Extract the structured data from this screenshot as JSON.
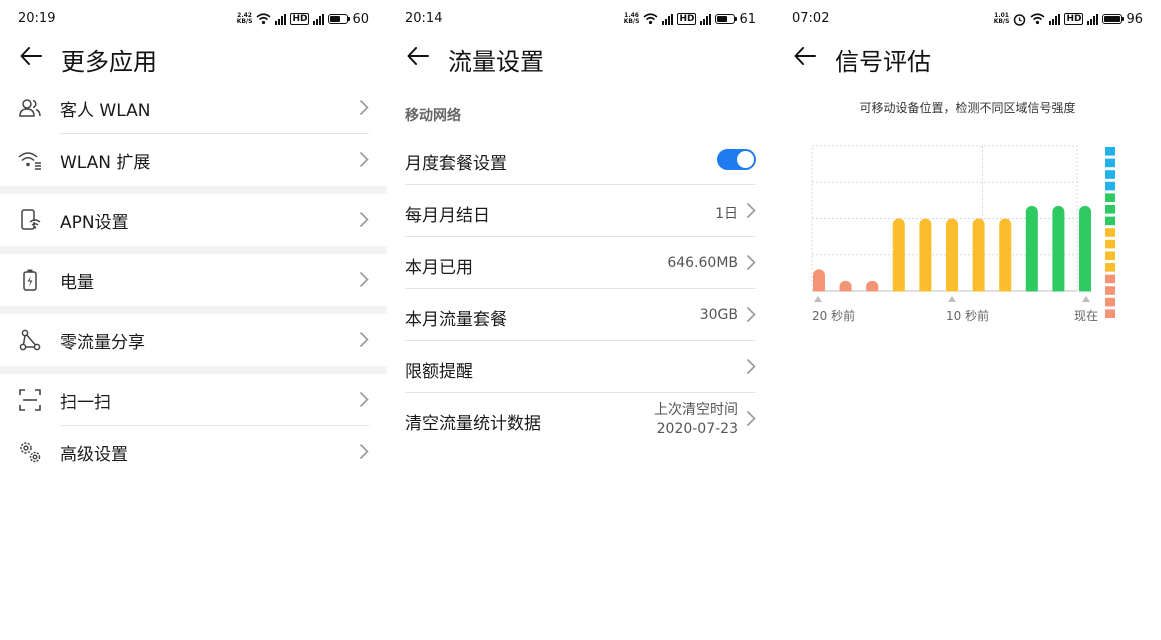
{
  "colors": {
    "accent": "#1e7cf0",
    "bar_weak": "#f39574",
    "bar_medium": "#fbbd2b",
    "bar_strong": "#2fc962",
    "legend_blue": "#22b1eb"
  },
  "panel1": {
    "status": {
      "time": "20:19",
      "speed_top": "2.42",
      "speed_bottom": "KB/S",
      "hd": "HD",
      "battery": "60",
      "battery_level": 0.6
    },
    "title": "更多应用",
    "items": [
      {
        "icon": "guest-users-icon",
        "label": "客人 WLAN"
      },
      {
        "icon": "wifi-extend-icon",
        "label": "WLAN 扩展"
      },
      {
        "icon": "apn-phone-icon",
        "label": "APN设置"
      },
      {
        "icon": "battery-charge-icon",
        "label": "电量"
      },
      {
        "icon": "share-nodes-icon",
        "label": "零流量分享"
      },
      {
        "icon": "scan-icon",
        "label": "扫一扫"
      },
      {
        "icon": "gears-icon",
        "label": "高级设置"
      }
    ]
  },
  "panel2": {
    "status": {
      "time": "20:14",
      "speed_top": "1.46",
      "speed_bottom": "KB/S",
      "hd": "HD",
      "battery": "61",
      "battery_level": 0.61
    },
    "title": "流量设置",
    "section": "移动网络",
    "items": [
      {
        "label": "月度套餐设置",
        "toggle": true
      },
      {
        "label": "每月月结日",
        "value": "1日"
      },
      {
        "label": "本月已用",
        "value": "646.60MB"
      },
      {
        "label": "本月流量套餐",
        "value": "30GB"
      },
      {
        "label": "限额提醒",
        "value": ""
      },
      {
        "label": "清空流量统计数据",
        "value_line1": "上次清空时间",
        "value_line2": "2020-07-23"
      }
    ]
  },
  "panel3": {
    "status": {
      "time": "07:02",
      "speed_top": "1.01",
      "speed_bottom": "KB/S",
      "hd": "HD",
      "battery": "96",
      "battery_level": 0.96
    },
    "title": "信号评估",
    "hint": "可移动设备位置，检测不同区域信号强度",
    "chart_data": {
      "type": "bar",
      "ylim": [
        0,
        4
      ],
      "grid": true,
      "bars": [
        {
          "value": 0.6,
          "level": "weak"
        },
        {
          "value": 0.28,
          "level": "weak"
        },
        {
          "value": 0.28,
          "level": "weak"
        },
        {
          "value": 2.0,
          "level": "medium"
        },
        {
          "value": 2.0,
          "level": "medium"
        },
        {
          "value": 2.0,
          "level": "medium"
        },
        {
          "value": 2.0,
          "level": "medium"
        },
        {
          "value": 2.0,
          "level": "medium"
        },
        {
          "value": 2.35,
          "level": "strong"
        },
        {
          "value": 2.35,
          "level": "strong"
        },
        {
          "value": 2.35,
          "level": "strong"
        }
      ],
      "x_ticks": [
        "20 秒前",
        "10 秒前",
        "现在"
      ],
      "legend_scale": [
        "blue",
        "blue",
        "blue",
        "blue",
        "strong",
        "strong",
        "strong",
        "medium",
        "medium",
        "medium",
        "medium",
        "weak",
        "weak",
        "weak",
        "weak"
      ]
    }
  }
}
